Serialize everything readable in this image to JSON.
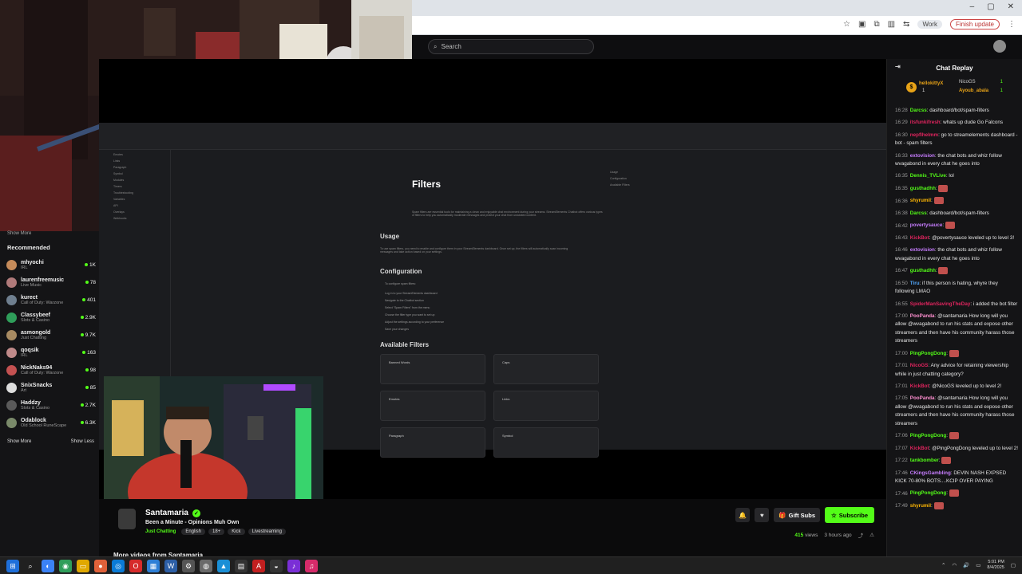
{
  "browser": {
    "profile_label": "Work",
    "finish_update_label": "Finish update",
    "window_buttons": [
      "–",
      "▢",
      "✕"
    ]
  },
  "topbar": {
    "search_placeholder": "Search"
  },
  "sidebar": {
    "show_more_top": "Show More",
    "heading": "Recommended",
    "items": [
      {
        "name": "mhyochi",
        "category": "IRL",
        "viewers": "1K",
        "color": "#c58b5a"
      },
      {
        "name": "laurenfreemusic",
        "category": "Live Music",
        "viewers": "78",
        "color": "#b07a7a"
      },
      {
        "name": "kurect",
        "category": "Call of Duty: Warzone",
        "viewers": "401",
        "color": "#6f7f8f"
      },
      {
        "name": "Classybeef",
        "category": "Slots & Casino",
        "viewers": "2.9K",
        "color": "#2f9e5a"
      },
      {
        "name": "asmongold",
        "category": "Just Chatting",
        "viewers": "9.7K",
        "color": "#a88b62"
      },
      {
        "name": "qoqsik",
        "category": "IRL",
        "viewers": "163",
        "color": "#c08a8a"
      },
      {
        "name": "NickNaks94",
        "category": "Call of Duty: Warzone",
        "viewers": "98",
        "color": "#c45151"
      },
      {
        "name": "SnixSnacks",
        "category": "Art",
        "viewers": "85",
        "color": "#dddddd"
      },
      {
        "name": "Haddzy",
        "category": "Slots & Casino",
        "viewers": "2.7K",
        "color": "#5a5a5a"
      },
      {
        "name": "Odablock",
        "category": "Old School RuneScape",
        "viewers": "6.3K",
        "color": "#7a8a6a"
      }
    ],
    "show_more": "Show More",
    "show_less": "Show Less"
  },
  "video_doc": {
    "title": "Filters",
    "h_usage": "Usage",
    "h_config": "Configuration",
    "h_available": "Available Filters",
    "cards": [
      "Banned Words",
      "Caps",
      "Emotes",
      "Links",
      "Paragraph",
      "Symbol"
    ],
    "nav_items": [
      "Emotes",
      "Links",
      "Paragraph",
      "Symbol",
      "Modules",
      "Timers",
      "Troubleshooting",
      "Variables",
      "API",
      "Overlays",
      "Webhooks"
    ],
    "toc": [
      "Usage",
      "Configuration",
      "Available Filters"
    ],
    "config_steps": [
      "Log in to your StreamElements dashboard",
      "Navigate to the Chatbot section",
      "Select \"Spam Filters\" from the menu",
      "Choose the filter type you want to set up",
      "Adjust the settings according to your preference",
      "Save your changes"
    ]
  },
  "stream": {
    "streamer": "Santamaria",
    "title": "Been a Minute - Opinions Muh Own",
    "category": "Just Chatting",
    "tags": [
      "English",
      "18+",
      "Kick",
      "Livestreaming"
    ],
    "gift_subs": "Gift Subs",
    "subscribe": "Subscribe",
    "views_count": "415",
    "views_label": "views",
    "time_ago": "3 hours ago",
    "more_videos": "More videos from Santamaria"
  },
  "chat": {
    "title": "Chat Replay",
    "pinned": {
      "user1": "hellokittyX",
      "user1_count": "1",
      "user2": "NicoGS",
      "user2_count": "1",
      "user3": "Ayoub_abala",
      "user3_count": "1"
    },
    "messages": [
      {
        "ts": "16:28",
        "user": "Darcss",
        "color": "#53fc18",
        "text": "dashboard/bot/spam-filters"
      },
      {
        "ts": "16:29",
        "user": "itsfunkifresh",
        "color": "#e0245e",
        "text": "whats up dude Go Falcons"
      },
      {
        "ts": "16:30",
        "user": "nepflhelmm",
        "color": "#e0245e",
        "text": "go to streamelements dashboard - bot - spam filters"
      },
      {
        "ts": "16:33",
        "user": "extovision",
        "color": "#c77dff",
        "text": "the chat bots and whiz follow wvagabond in every chat he goes into"
      },
      {
        "ts": "16:35",
        "user": "Dennis_TVLive",
        "color": "#53fc18",
        "text": "lol"
      },
      {
        "ts": "16:35",
        "user": "gusthadhh",
        "color": "#53fc18",
        "text": ""
      },
      {
        "ts": "16:36",
        "user": "shyrumil",
        "color": "#ffb703",
        "text": ""
      },
      {
        "ts": "16:38",
        "user": "Darcss",
        "color": "#53fc18",
        "text": "dashboard/bot/spam-filters"
      },
      {
        "ts": "16:42",
        "user": "povertysauce",
        "color": "#c77dff",
        "text": ""
      },
      {
        "ts": "16:43",
        "user": "KickBot",
        "color": "#e0245e",
        "text": "@povertysauce leveled up to level 3!"
      },
      {
        "ts": "16:46",
        "user": "extovision",
        "color": "#c77dff",
        "text": "the chat bots and whiz follow wvagabond in every chat he goes into"
      },
      {
        "ts": "16:47",
        "user": "gusthadhh",
        "color": "#53fc18",
        "text": ""
      },
      {
        "ts": "16:50",
        "user": "Tiru",
        "color": "#53aaff",
        "text": "if this person is hating, whyre they following LMAO"
      },
      {
        "ts": "16:55",
        "user": "SpiderManSavingTheDay",
        "color": "#e0245e",
        "text": "i added the bot filter"
      },
      {
        "ts": "17:00",
        "user": "PooPanda",
        "color": "#ff8fd1",
        "text": "@santamaria How long will you allow @wvagabond to run his stats and expose other streamers and then have his community harass those streamers"
      },
      {
        "ts": "17:00",
        "user": "PingPongDong",
        "color": "#53fc18",
        "text": ""
      },
      {
        "ts": "17:01",
        "user": "NicoGS",
        "color": "#e0245e",
        "text": "Any advice for retaining viewership while in just chatting category?"
      },
      {
        "ts": "17:01",
        "user": "KickBot",
        "color": "#e0245e",
        "text": "@NicoGS leveled up to level 2!"
      },
      {
        "ts": "17:05",
        "user": "PooPanda",
        "color": "#ff8fd1",
        "text": "@santamaria How long will you allow @wvagabond to run his stats and expose other streamers and then have his community harass those streamers"
      },
      {
        "ts": "17:06",
        "user": "PingPongDong",
        "color": "#53fc18",
        "text": ""
      },
      {
        "ts": "17:07",
        "user": "KickBot",
        "color": "#e0245e",
        "text": "@PingPongDong leveled up to level 2!"
      },
      {
        "ts": "17:22",
        "user": "tankbomber",
        "color": "#53fc18",
        "text": ""
      },
      {
        "ts": "17:46",
        "user": "CKingsGambling",
        "color": "#c77dff",
        "text": "DEVIN NASH EXPSED KICK 70-80% BOTS....KCIP OVER PAYING"
      },
      {
        "ts": "17:46",
        "user": "PingPongDong",
        "color": "#53fc18",
        "text": ""
      },
      {
        "ts": "17:49",
        "user": "shyrumil",
        "color": "#ffb703",
        "text": ""
      }
    ]
  },
  "taskbar": {
    "time": "5:01 PM",
    "date": "8/4/2025"
  },
  "colors": {
    "kick_green": "#53fc18",
    "bg": "#0b0b0c",
    "panel": "#141416"
  }
}
